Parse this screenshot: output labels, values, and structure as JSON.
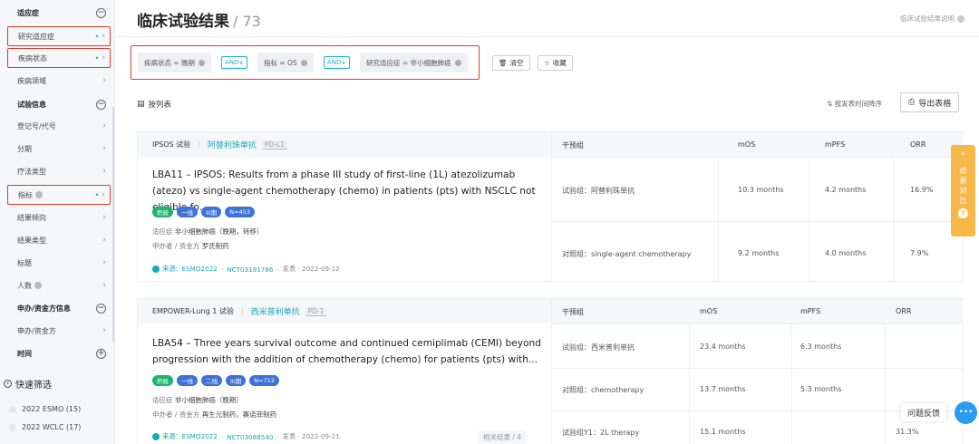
{
  "sidebar": {
    "groups": [
      {
        "label": "适应症",
        "icon": "minus-circle-icon"
      },
      {
        "label": "试验信息",
        "icon": "minus-circle-icon"
      },
      {
        "label": "申办/资金方信息",
        "icon": "minus-circle-icon"
      },
      {
        "label": "时间",
        "icon": "plus-circle-icon"
      }
    ],
    "items": [
      {
        "label": "研究适应症",
        "active": true
      },
      {
        "label": "疾病状态",
        "active": true
      },
      {
        "label": "疾病领域",
        "active": false
      },
      {
        "label": "登记号/代号",
        "active": false
      },
      {
        "label": "分期",
        "active": false
      },
      {
        "label": "疗法类型",
        "active": false
      },
      {
        "label": "指标",
        "active": true
      },
      {
        "label": "结果倾向",
        "active": false
      },
      {
        "label": "结果类型",
        "active": false
      },
      {
        "label": "标题",
        "active": false
      },
      {
        "label": "人数",
        "active": false
      },
      {
        "label": "申办/资金方",
        "active": false
      }
    ],
    "quick_filter": {
      "title": "快速筛选",
      "items": [
        "2022 ESMO  (15)",
        "2022 WCLC  (17)"
      ]
    }
  },
  "header": {
    "title": "临床试验结果",
    "count": "/ 73",
    "help": "临床试验结果说明"
  },
  "filters": {
    "chips": [
      "疾病状态 = 晚期",
      "指标 = OS",
      "研究适应症 = 非小细胞肺癌"
    ],
    "and_label": "AND∨",
    "clear": "清空",
    "save": "收藏"
  },
  "toolbar": {
    "list_view": "按列表",
    "sort": "按发表时间降序",
    "export": "导出表格"
  },
  "colors": {
    "accent": "#19a7b8",
    "positive": "#20b36b",
    "tag": "#3f72d7",
    "highlight": "#e03a2f",
    "compare": "#f7b84a"
  },
  "cards": [
    {
      "trial": "IPSOS 试验",
      "drug": "阿替利珠单抗",
      "target": "PD-L1",
      "title": "LBA11 – IPSOS: Results from a phase III study of first-line (1L) atezolizumab (atezo) vs single-agent chemotherapy (chemo) in patients (pts) with NSCLC not eligible fo...",
      "tags": [
        "积极",
        "一线",
        "III期",
        "N=453"
      ],
      "indication_label": "适应症",
      "indication": "非小细胞肺癌（晚期，转移）",
      "sponsor_label": "申办者 / 资金方",
      "sponsor": "罗氏制药",
      "source": "来源：ESMO2022",
      "nct": "NCT03191786",
      "published": "发表 · 2022-09-12",
      "columns": [
        "干预组",
        "mOS",
        "mPFS",
        "ORR"
      ],
      "rows": [
        {
          "arm": "试验组：阿替利珠单抗",
          "mos": "10.3 months",
          "mpfs": "4.2 months",
          "orr": "16.9%"
        },
        {
          "arm": "对照组：single-agent chemotherapy",
          "mos": "9.2 months",
          "mpfs": "4.0 months",
          "orr": "7.9%"
        }
      ]
    },
    {
      "trial": "EMPOWER-Lung 1 试验",
      "drug": "西米普利单抗",
      "target": "PD-1",
      "title": "LBA54 – Three years survival outcome and continued cemiplimab (CEMI) beyond progression with the addition of chemotherapy (chemo) for patients (pts) with...",
      "tags": [
        "积极",
        "一线",
        "二线",
        "III期",
        "N=712"
      ],
      "indication_label": "适应症",
      "indication": "非小细胞肺癌（晚期）",
      "sponsor_label": "申办者 / 资金方",
      "sponsor": "再生元制药，赛诺菲制药",
      "source": "来源：ESMO2022",
      "nct": "NCT03088540",
      "published": "发表 · 2022-09-11",
      "related": "相关结果 / 4",
      "columns": [
        "干预组",
        "mOS",
        "mPFS",
        "ORR"
      ],
      "rows": [
        {
          "arm": "试验组：西米普利单抗",
          "mos": "23.4 months",
          "mpfs": "6.3 months",
          "orr": ""
        },
        {
          "arm": "对照组：chemotherapy",
          "mos": "13.7 months",
          "mpfs": "5.3 months",
          "orr": ""
        },
        {
          "arm": "试验组Y1：2L therapy",
          "mos": "15.1 months",
          "mpfs": "",
          "orr": "31.3%"
        }
      ]
    }
  ],
  "side": {
    "compare": "结果对比",
    "compare_count": "0",
    "collapse": "«",
    "feedback": "问题反馈"
  }
}
